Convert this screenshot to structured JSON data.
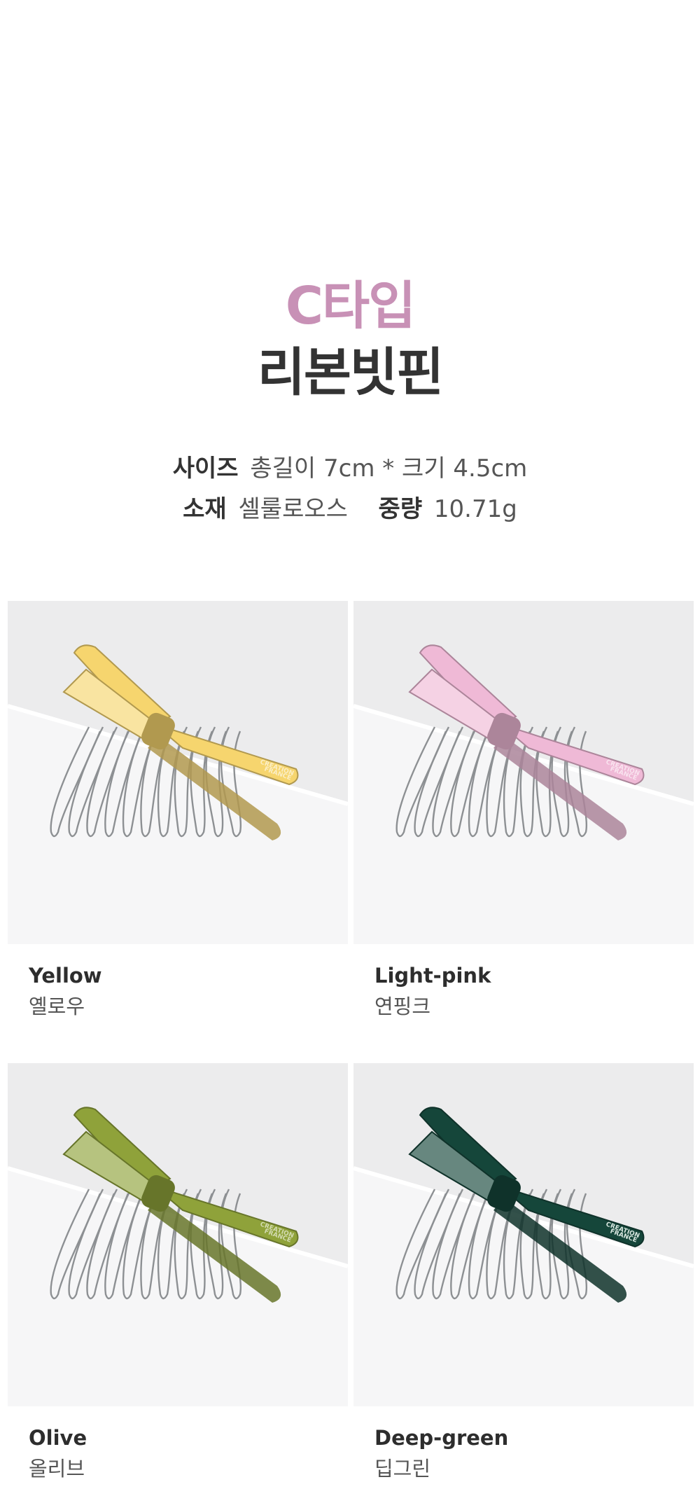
{
  "header": {
    "subtitle": "C타입",
    "title": "리본빗핀",
    "accent_color": "#c891b6"
  },
  "specs": {
    "size_label": "사이즈",
    "size_value": "총길이 7cm * 크기 4.5cm",
    "material_label": "소재",
    "material_value": "셀룰로오스",
    "weight_label": "중량",
    "weight_value": "10.71g"
  },
  "products": [
    {
      "name_en": "Yellow",
      "name_ko": "옐로우",
      "color": "#f6d56e",
      "logo_lines": [
        "CREATION",
        "FRANCE"
      ]
    },
    {
      "name_en": "Light-pink",
      "name_ko": "연핑크",
      "color": "#efb9d6",
      "logo_lines": [
        "CREATION",
        "FRANCE"
      ]
    },
    {
      "name_en": "Olive",
      "name_ko": "올리브",
      "color": "#8fa23a",
      "logo_lines": [
        "CREATION",
        "FRANCE"
      ]
    },
    {
      "name_en": "Deep-green",
      "name_ko": "딥그린",
      "color": "#15463a",
      "logo_lines": [
        "CREATION",
        "FRANCE"
      ]
    }
  ]
}
